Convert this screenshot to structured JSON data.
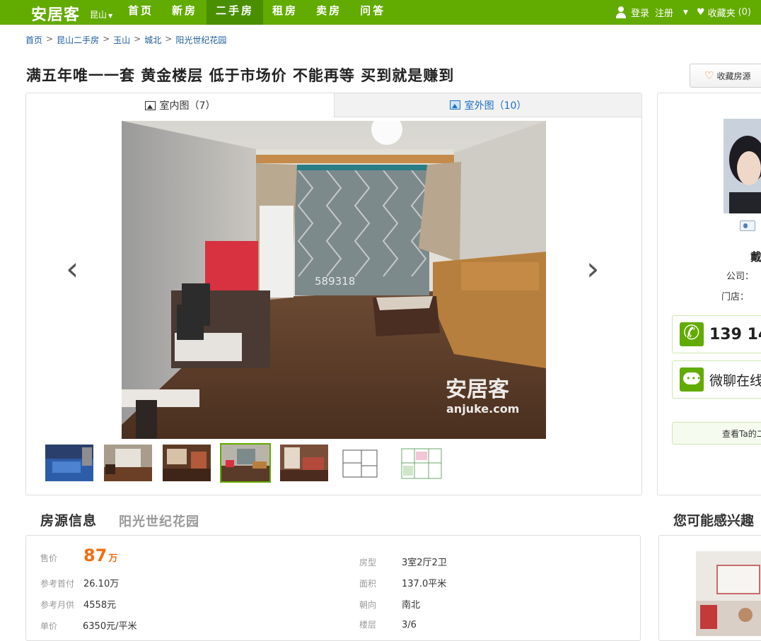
{
  "header": {
    "logo": "安居客",
    "city": "昆山",
    "nav": [
      "首页",
      "新房",
      "二手房",
      "租房",
      "卖房",
      "问答"
    ],
    "active_nav": "二手房",
    "login": "登录",
    "register": "注册",
    "favorites_label": "收藏夹",
    "favorites_count": "(0)",
    "brand_color": "#62ab00"
  },
  "breadcrumb": [
    "首页",
    "昆山二手房",
    "玉山",
    "城北",
    "阳光世纪花园"
  ],
  "title": "满五年唯一一套 黄金楼层 低于市场价 不能再等 买到就是赚到",
  "favorite_listing_button": "收藏房源",
  "gallery": {
    "tabs": [
      {
        "label": "室内图（7）",
        "active": true
      },
      {
        "label": "室外图（10）",
        "active": false
      }
    ],
    "photo_id_watermark": "589318",
    "watermark_logo": "安居客",
    "watermark_domain": "anjuke.com",
    "prev_arrow": "‹",
    "next_arrow": "›",
    "thumbnail_count": 7,
    "selected_thumbnail": 4
  },
  "agent": {
    "name": "戴",
    "company_label": "公司：",
    "store_label": "门店：",
    "phone": "139 14",
    "wechat": "微聊在线",
    "other_listings_button": "查看Ta的二手房"
  },
  "listing": {
    "section_title": "房源信息",
    "community": "阳光世纪花园",
    "price_label": "售价",
    "price": "87",
    "price_unit": "万",
    "rows_left": [
      {
        "label": "参考首付",
        "value": "26.10万"
      },
      {
        "label": "参考月供",
        "value": "4558元"
      },
      {
        "label": "单价",
        "value": "6350元/平米"
      }
    ],
    "rows_right": [
      {
        "label": "房型",
        "value": "3室2厅2卫"
      },
      {
        "label": "面积",
        "value": "137.0平米"
      },
      {
        "label": "朝向",
        "value": "南北"
      },
      {
        "label": "楼层",
        "value": "3/6"
      }
    ],
    "price_color": "#f26d11"
  },
  "recommend": {
    "title": "您可能感兴趣"
  }
}
